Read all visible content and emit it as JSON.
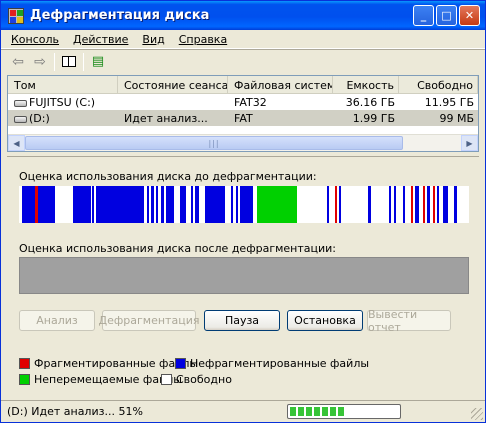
{
  "window": {
    "title": "Дефрагментация диска"
  },
  "menu": [
    "Консоль",
    "Действие",
    "Вид",
    "Справка"
  ],
  "toolbar": {
    "back_icon": "arrow-left-icon",
    "forward_icon": "arrow-right-icon",
    "panel_icon": "show-hide-tree-icon",
    "properties_icon": "properties-icon"
  },
  "volumes": {
    "headers": [
      "Том",
      "Состояние сеанса",
      "Файловая система",
      "Емкость",
      "Свободно"
    ],
    "rows": [
      {
        "volume": "FUJITSU (C:)",
        "status": "",
        "fs": "FAT32",
        "capacity": "36.16 ГБ",
        "free": "11.95 ГБ"
      },
      {
        "volume": "(D:)",
        "status": "Идет анализ...",
        "fs": "FAT",
        "capacity": "1.99 ГБ",
        "free": "99 МБ"
      }
    ]
  },
  "labels": {
    "before": "Оценка использования диска до дефрагментации:",
    "after": "Оценка использования диска после дефрагментации:"
  },
  "buttons": [
    "Анализ",
    "Дефрагментация",
    "Пауза",
    "Остановка",
    "Вывести отчет"
  ],
  "legend": {
    "fragmented": "Фрагментированные файлы",
    "contiguous": "Нефрагментированные файлы",
    "unmovable": "Неперемещаемые файлы",
    "free": "Свободно"
  },
  "colors": {
    "fragmented": "#e00000",
    "contiguous": "#0000e0",
    "unmovable": "#00d000",
    "free": "#ffffff"
  },
  "status": {
    "text": "(D:) Идет анализ... 51%",
    "progress": 0.51
  }
}
